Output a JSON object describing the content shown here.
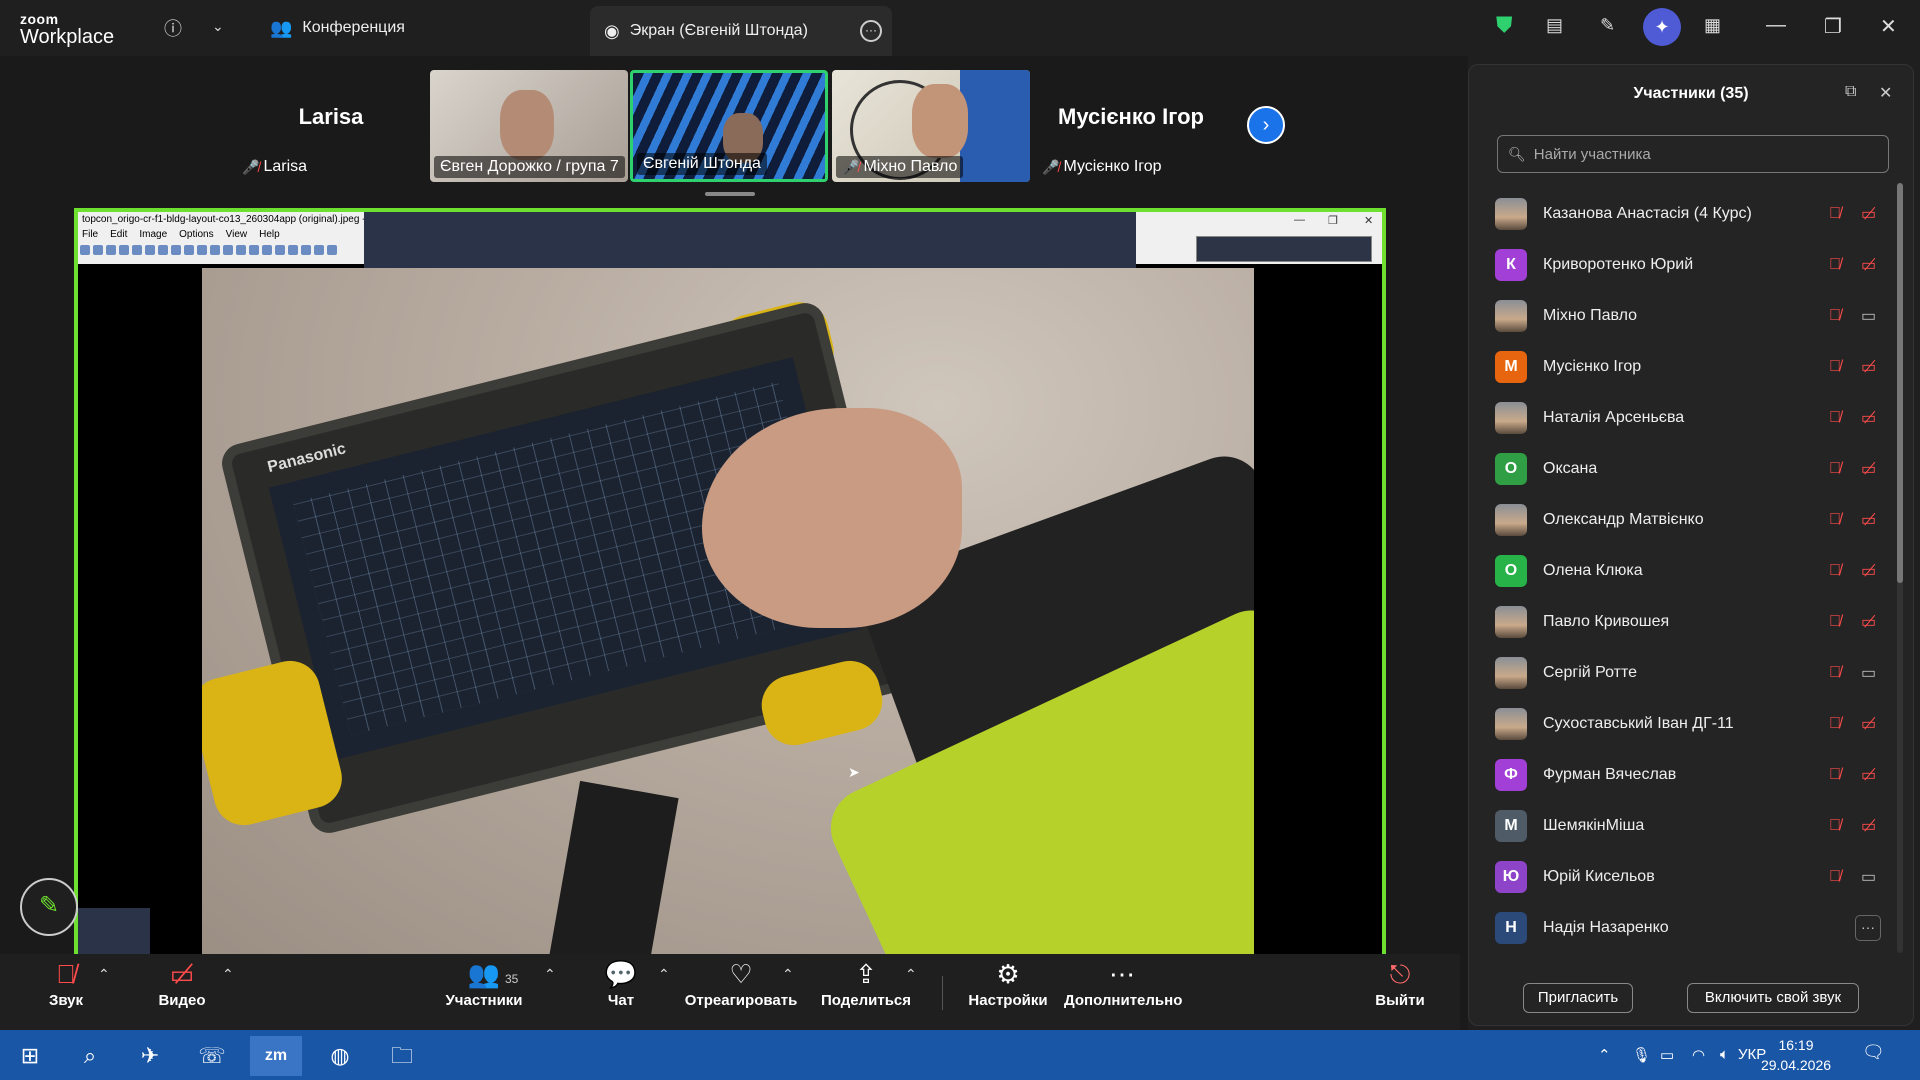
{
  "app": {
    "logo_top": "zoom",
    "logo_bottom": "Workplace",
    "tab_conference": "Конференция",
    "tab_screen": "Экран (Євгеній Штонда)"
  },
  "strip": {
    "name_tiles": [
      {
        "big": "Larisa",
        "label": "Larisa"
      },
      {
        "big": "Мусієнко Ігор",
        "label": "Мусієнко Ігор"
      }
    ],
    "video_tiles": [
      {
        "label": "Євген Дорожко / група 7",
        "muted": false
      },
      {
        "label": "Євгеній Штонда",
        "muted": false,
        "active": true
      },
      {
        "label": "Міхно Павло",
        "muted": true
      }
    ]
  },
  "shared": {
    "window_title": "topcon_origo-cr-f1-bldg-layout-co13_260304app (original).jpeg -",
    "menu": [
      "File",
      "Edit",
      "Image",
      "Options",
      "View",
      "Help"
    ],
    "tablet_brand": "Panasonic"
  },
  "toolbar": {
    "audio": "Звук",
    "video": "Видео",
    "participants": "Участники",
    "participants_count": "35",
    "chat": "Чат",
    "react": "Отреагировать",
    "share": "Поделиться",
    "settings": "Настройки",
    "more": "Дополнительно",
    "leave": "Выйти"
  },
  "panel": {
    "title": "Участники (35)",
    "search_placeholder": "Найти участника",
    "invite": "Пригласить",
    "unmute_self": "Включить свой звук",
    "participants": [
      {
        "name": "Казанова Анастасія (4 Курс)",
        "avatar": "",
        "color": "#8e6a5a",
        "photo": true,
        "cam": "off"
      },
      {
        "name": "Криворотенко Юрий",
        "avatar": "К",
        "color": "#a23fd6",
        "photo": false,
        "cam": "off"
      },
      {
        "name": "Міхно Павло",
        "avatar": "",
        "color": "#777777",
        "photo": true,
        "cam": "on"
      },
      {
        "name": "Мусієнко Ігор",
        "avatar": "М",
        "color": "#e8650f",
        "photo": false,
        "cam": "off"
      },
      {
        "name": "Наталія Арсеньєва",
        "avatar": "",
        "color": "#7a8a6a",
        "photo": true,
        "cam": "off"
      },
      {
        "name": "Оксана",
        "avatar": "О",
        "color": "#2f9e44",
        "photo": false,
        "cam": "off"
      },
      {
        "name": "Олександр Матвієнко",
        "avatar": "",
        "color": "#8a7d55",
        "photo": true,
        "cam": "off"
      },
      {
        "name": "Олена Клюка",
        "avatar": "О",
        "color": "#27b348",
        "photo": false,
        "cam": "off"
      },
      {
        "name": "Павло Кривошея",
        "avatar": "",
        "color": "#5d6670",
        "photo": true,
        "cam": "off"
      },
      {
        "name": "Сергій Ротте",
        "avatar": "",
        "color": "#6c8a5c",
        "photo": true,
        "cam": "on"
      },
      {
        "name": "Сухоставський Іван ДГ-11",
        "avatar": "",
        "color": "#5c6e5a",
        "photo": true,
        "cam": "off"
      },
      {
        "name": "Фурман Вячеслав",
        "avatar": "Ф",
        "color": "#a23fd6",
        "photo": false,
        "cam": "off"
      },
      {
        "name": "ШемякінМіша",
        "avatar": "М",
        "color": "#4f5b66",
        "photo": false,
        "cam": "off"
      },
      {
        "name": "Юрій Кисельов",
        "avatar": "Ю",
        "color": "#8e44c9",
        "photo": false,
        "cam": "on"
      },
      {
        "name": "Надія Назаренко",
        "avatar": "Н",
        "color": "#2b4a7a",
        "photo": false,
        "cam": "more"
      }
    ]
  },
  "taskbar": {
    "lang": "УКР",
    "time": "16:19",
    "date": "29.04.2026"
  }
}
